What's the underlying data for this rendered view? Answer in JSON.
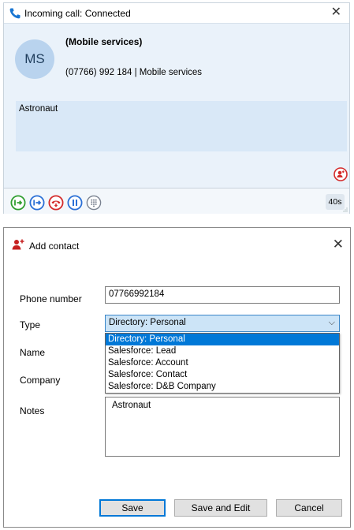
{
  "call": {
    "title": "Incoming call: Connected",
    "avatar_initials": "MS",
    "caller_name": "(Mobile services)",
    "caller_line": "(07766) 992 184  |  Mobile services",
    "notes": "Astronaut",
    "duration": "40s",
    "controls": [
      "transfer-icon",
      "consult-icon",
      "hangup-icon",
      "hold-icon",
      "keypad-icon"
    ],
    "colors": {
      "green": "#2f9e2f",
      "blue": "#2a6fd6",
      "red": "#d42a2a",
      "panel": "#eaf2fa"
    }
  },
  "dialog": {
    "title": "Add contact",
    "phone_label": "Phone number",
    "phone_value": "07766992184",
    "type_label": "Type",
    "type_value": "Directory: Personal",
    "type_options": [
      "Directory: Personal",
      "Salesforce: Lead",
      "Salesforce: Account",
      "Salesforce: Contact",
      "Salesforce: D&B Company"
    ],
    "name_label": "Name",
    "company_label": "Company",
    "notes_label": "Notes",
    "notes_value": "Astronaut",
    "save_label": "Save",
    "save_edit_label": "Save and Edit",
    "cancel_label": "Cancel"
  }
}
